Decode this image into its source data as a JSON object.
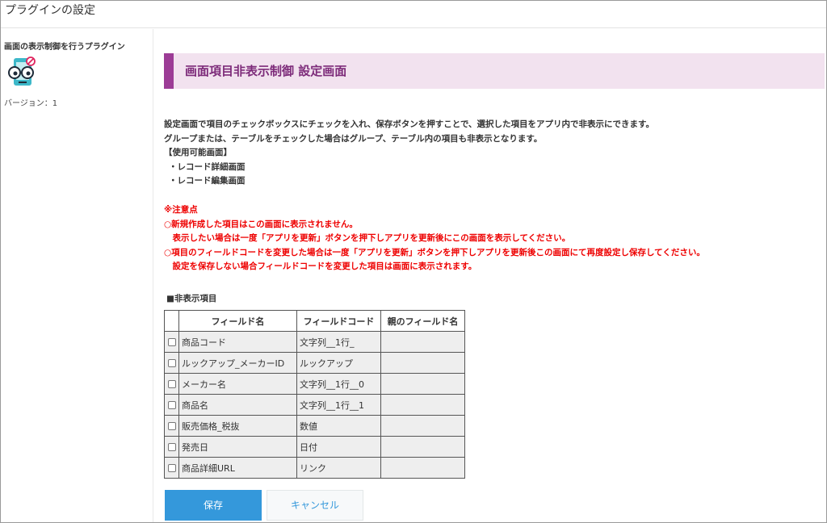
{
  "header": {
    "title": "プラグインの設定"
  },
  "sidebar": {
    "plugin_name": "画面の表示制御を行うプラグイン",
    "version": "バージョン：1",
    "icon": "eye-slash-icon"
  },
  "main": {
    "title": "画面項目非表示制御 設定画面",
    "description": [
      "設定画面で項目のチェックボックスにチェックを入れ、保存ボタンを押すことで、選択した項目をアプリ内で非表示にできます。",
      "グループまたは、テーブルをチェックした場合はグループ、テーブル内の項目も非表示となります。",
      "【使用可能画面】",
      "・レコード詳細画面",
      "・レコード編集画面"
    ],
    "notice": [
      "※注意点",
      "○新規作成した項目はこの画面に表示されません。",
      "　表示したい場合は一度「アプリを更新」ボタンを押下しアプリを更新後にこの画面を表示してください。",
      "○項目のフィールドコードを変更した場合は一度「アプリを更新」ボタンを押下しアプリを更新後この画面にて再度設定し保存してください。",
      "　設定を保存しない場合フィールドコードを変更した項目は画面に表示されます。"
    ],
    "section_label": "■非表示項目",
    "table": {
      "headers": [
        "フィールド名",
        "フィールドコード",
        "親のフィールド名"
      ],
      "rows": [
        {
          "name": "商品コード",
          "code": "文字列__1行_",
          "parent": "",
          "checked": false
        },
        {
          "name": "ルックアップ_メーカーID",
          "code": "ルックアップ",
          "parent": "",
          "checked": false
        },
        {
          "name": "メーカー名",
          "code": "文字列__1行__0",
          "parent": "",
          "checked": false
        },
        {
          "name": "商品名",
          "code": "文字列__1行__1",
          "parent": "",
          "checked": false
        },
        {
          "name": "販売価格_税抜",
          "code": "数値",
          "parent": "",
          "checked": false
        },
        {
          "name": "発売日",
          "code": "日付",
          "parent": "",
          "checked": false
        },
        {
          "name": "商品詳細URL",
          "code": "リンク",
          "parent": "",
          "checked": false
        }
      ]
    },
    "buttons": {
      "save": "保存",
      "cancel": "キャンセル"
    }
  },
  "colors": {
    "accent_purple": "#9c3c96",
    "title_bg": "#f2e2ef",
    "notice_red": "#ee0000",
    "save_blue": "#3498db"
  }
}
